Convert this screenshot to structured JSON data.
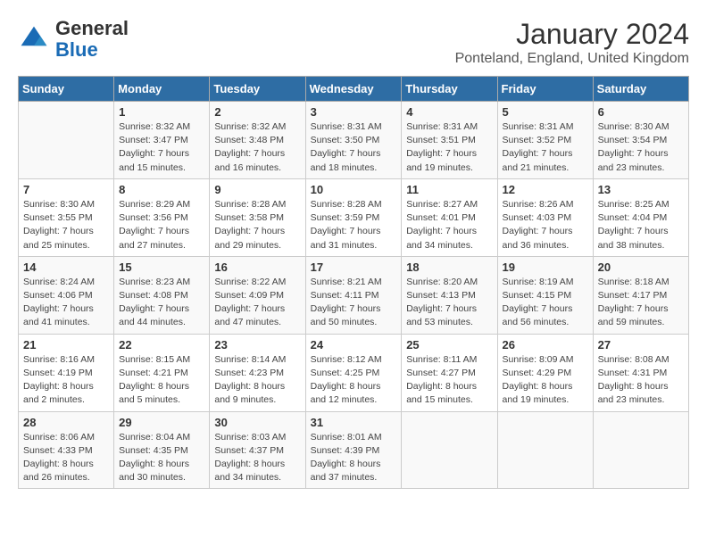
{
  "logo": {
    "general": "General",
    "blue": "Blue"
  },
  "title": "January 2024",
  "subtitle": "Ponteland, England, United Kingdom",
  "weekdays": [
    "Sunday",
    "Monday",
    "Tuesday",
    "Wednesday",
    "Thursday",
    "Friday",
    "Saturday"
  ],
  "weeks": [
    [
      {
        "day": "",
        "sunrise": "",
        "sunset": "",
        "daylight": ""
      },
      {
        "day": "1",
        "sunrise": "Sunrise: 8:32 AM",
        "sunset": "Sunset: 3:47 PM",
        "daylight": "Daylight: 7 hours and 15 minutes."
      },
      {
        "day": "2",
        "sunrise": "Sunrise: 8:32 AM",
        "sunset": "Sunset: 3:48 PM",
        "daylight": "Daylight: 7 hours and 16 minutes."
      },
      {
        "day": "3",
        "sunrise": "Sunrise: 8:31 AM",
        "sunset": "Sunset: 3:50 PM",
        "daylight": "Daylight: 7 hours and 18 minutes."
      },
      {
        "day": "4",
        "sunrise": "Sunrise: 8:31 AM",
        "sunset": "Sunset: 3:51 PM",
        "daylight": "Daylight: 7 hours and 19 minutes."
      },
      {
        "day": "5",
        "sunrise": "Sunrise: 8:31 AM",
        "sunset": "Sunset: 3:52 PM",
        "daylight": "Daylight: 7 hours and 21 minutes."
      },
      {
        "day": "6",
        "sunrise": "Sunrise: 8:30 AM",
        "sunset": "Sunset: 3:54 PM",
        "daylight": "Daylight: 7 hours and 23 minutes."
      }
    ],
    [
      {
        "day": "7",
        "sunrise": "Sunrise: 8:30 AM",
        "sunset": "Sunset: 3:55 PM",
        "daylight": "Daylight: 7 hours and 25 minutes."
      },
      {
        "day": "8",
        "sunrise": "Sunrise: 8:29 AM",
        "sunset": "Sunset: 3:56 PM",
        "daylight": "Daylight: 7 hours and 27 minutes."
      },
      {
        "day": "9",
        "sunrise": "Sunrise: 8:28 AM",
        "sunset": "Sunset: 3:58 PM",
        "daylight": "Daylight: 7 hours and 29 minutes."
      },
      {
        "day": "10",
        "sunrise": "Sunrise: 8:28 AM",
        "sunset": "Sunset: 3:59 PM",
        "daylight": "Daylight: 7 hours and 31 minutes."
      },
      {
        "day": "11",
        "sunrise": "Sunrise: 8:27 AM",
        "sunset": "Sunset: 4:01 PM",
        "daylight": "Daylight: 7 hours and 34 minutes."
      },
      {
        "day": "12",
        "sunrise": "Sunrise: 8:26 AM",
        "sunset": "Sunset: 4:03 PM",
        "daylight": "Daylight: 7 hours and 36 minutes."
      },
      {
        "day": "13",
        "sunrise": "Sunrise: 8:25 AM",
        "sunset": "Sunset: 4:04 PM",
        "daylight": "Daylight: 7 hours and 38 minutes."
      }
    ],
    [
      {
        "day": "14",
        "sunrise": "Sunrise: 8:24 AM",
        "sunset": "Sunset: 4:06 PM",
        "daylight": "Daylight: 7 hours and 41 minutes."
      },
      {
        "day": "15",
        "sunrise": "Sunrise: 8:23 AM",
        "sunset": "Sunset: 4:08 PM",
        "daylight": "Daylight: 7 hours and 44 minutes."
      },
      {
        "day": "16",
        "sunrise": "Sunrise: 8:22 AM",
        "sunset": "Sunset: 4:09 PM",
        "daylight": "Daylight: 7 hours and 47 minutes."
      },
      {
        "day": "17",
        "sunrise": "Sunrise: 8:21 AM",
        "sunset": "Sunset: 4:11 PM",
        "daylight": "Daylight: 7 hours and 50 minutes."
      },
      {
        "day": "18",
        "sunrise": "Sunrise: 8:20 AM",
        "sunset": "Sunset: 4:13 PM",
        "daylight": "Daylight: 7 hours and 53 minutes."
      },
      {
        "day": "19",
        "sunrise": "Sunrise: 8:19 AM",
        "sunset": "Sunset: 4:15 PM",
        "daylight": "Daylight: 7 hours and 56 minutes."
      },
      {
        "day": "20",
        "sunrise": "Sunrise: 8:18 AM",
        "sunset": "Sunset: 4:17 PM",
        "daylight": "Daylight: 7 hours and 59 minutes."
      }
    ],
    [
      {
        "day": "21",
        "sunrise": "Sunrise: 8:16 AM",
        "sunset": "Sunset: 4:19 PM",
        "daylight": "Daylight: 8 hours and 2 minutes."
      },
      {
        "day": "22",
        "sunrise": "Sunrise: 8:15 AM",
        "sunset": "Sunset: 4:21 PM",
        "daylight": "Daylight: 8 hours and 5 minutes."
      },
      {
        "day": "23",
        "sunrise": "Sunrise: 8:14 AM",
        "sunset": "Sunset: 4:23 PM",
        "daylight": "Daylight: 8 hours and 9 minutes."
      },
      {
        "day": "24",
        "sunrise": "Sunrise: 8:12 AM",
        "sunset": "Sunset: 4:25 PM",
        "daylight": "Daylight: 8 hours and 12 minutes."
      },
      {
        "day": "25",
        "sunrise": "Sunrise: 8:11 AM",
        "sunset": "Sunset: 4:27 PM",
        "daylight": "Daylight: 8 hours and 15 minutes."
      },
      {
        "day": "26",
        "sunrise": "Sunrise: 8:09 AM",
        "sunset": "Sunset: 4:29 PM",
        "daylight": "Daylight: 8 hours and 19 minutes."
      },
      {
        "day": "27",
        "sunrise": "Sunrise: 8:08 AM",
        "sunset": "Sunset: 4:31 PM",
        "daylight": "Daylight: 8 hours and 23 minutes."
      }
    ],
    [
      {
        "day": "28",
        "sunrise": "Sunrise: 8:06 AM",
        "sunset": "Sunset: 4:33 PM",
        "daylight": "Daylight: 8 hours and 26 minutes."
      },
      {
        "day": "29",
        "sunrise": "Sunrise: 8:04 AM",
        "sunset": "Sunset: 4:35 PM",
        "daylight": "Daylight: 8 hours and 30 minutes."
      },
      {
        "day": "30",
        "sunrise": "Sunrise: 8:03 AM",
        "sunset": "Sunset: 4:37 PM",
        "daylight": "Daylight: 8 hours and 34 minutes."
      },
      {
        "day": "31",
        "sunrise": "Sunrise: 8:01 AM",
        "sunset": "Sunset: 4:39 PM",
        "daylight": "Daylight: 8 hours and 37 minutes."
      },
      {
        "day": "",
        "sunrise": "",
        "sunset": "",
        "daylight": ""
      },
      {
        "day": "",
        "sunrise": "",
        "sunset": "",
        "daylight": ""
      },
      {
        "day": "",
        "sunrise": "",
        "sunset": "",
        "daylight": ""
      }
    ]
  ]
}
